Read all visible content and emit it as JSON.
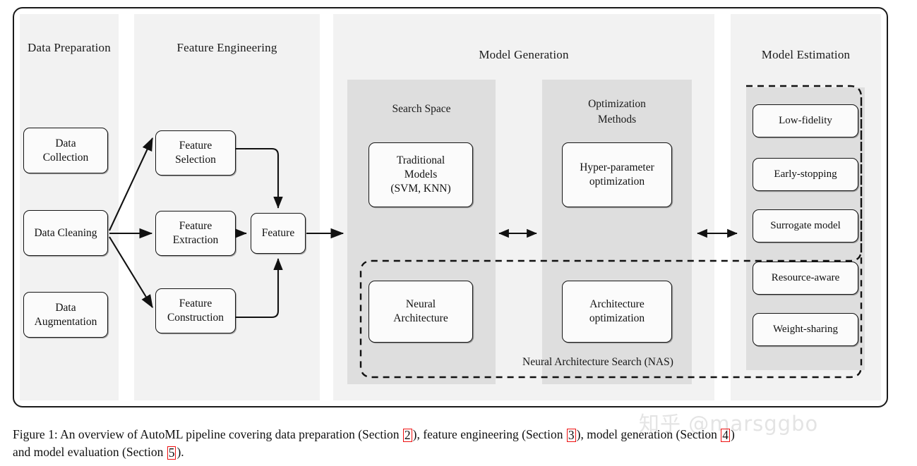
{
  "figure": {
    "stages": [
      {
        "id": "data-preparation",
        "title": "Data Preparation",
        "nodes": [
          {
            "id": "data-collection",
            "label": "Data\nCollection"
          },
          {
            "id": "data-cleaning",
            "label": "Data Cleaning"
          },
          {
            "id": "data-augmentation",
            "label": "Data\nAugmentation"
          }
        ]
      },
      {
        "id": "feature-engineering",
        "title": "Feature Engineering",
        "nodes": [
          {
            "id": "feature-selection",
            "label": "Feature\nSelection"
          },
          {
            "id": "feature-extraction",
            "label": "Feature\nExtraction"
          },
          {
            "id": "feature-construction",
            "label": "Feature\nConstruction"
          },
          {
            "id": "feature",
            "label": "Feature"
          }
        ]
      },
      {
        "id": "model-generation",
        "title": "Model Generation",
        "subpanels": [
          {
            "id": "search-space",
            "title": "Search Space",
            "nodes": [
              {
                "id": "traditional-models",
                "label": "Traditional\nModels\n(SVM, KNN)"
              },
              {
                "id": "neural-architecture",
                "label": "Neural\nArchitecture"
              }
            ]
          },
          {
            "id": "optimization-methods",
            "title": "Optimization\nMethods",
            "nodes": [
              {
                "id": "hyper-parameter-optimization",
                "label": "Hyper-parameter\noptimization"
              },
              {
                "id": "architecture-optimization",
                "label": "Architecture\noptimization"
              }
            ]
          }
        ],
        "nas_label": "Neural Architecture Search (NAS)"
      },
      {
        "id": "model-estimation",
        "title": "Model Estimation",
        "nodes": [
          {
            "id": "low-fidelity",
            "label": "Low-fidelity"
          },
          {
            "id": "early-stopping",
            "label": "Early-stopping"
          },
          {
            "id": "surrogate-model",
            "label": "Surrogate model"
          },
          {
            "id": "resource-aware",
            "label": "Resource-aware"
          },
          {
            "id": "weight-sharing",
            "label": "Weight-sharing"
          }
        ]
      }
    ],
    "caption": {
      "line1_a": "Figure 1: An overview of AutoML pipeline covering data preparation (Section ",
      "link2": "2",
      "line1_b": "), feature engineering (Section ",
      "link3": "3",
      "line1_c": "), model generation (Section ",
      "link4": "4",
      "line1_d": ")",
      "line2_a": "and model evaluation (Section ",
      "link5": "5",
      "line2_b": ")."
    },
    "watermark": "知乎 @marsggbo",
    "colors": {
      "panel_bg": "#f2f2f2",
      "subpanel_bg": "#dedede",
      "node_bg": "#fbfbfb",
      "stroke": "#151515",
      "link_box": "#ee1111",
      "watermark": "#e4e4e4"
    }
  }
}
